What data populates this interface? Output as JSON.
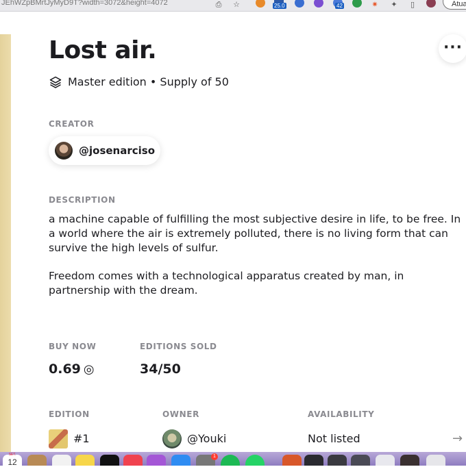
{
  "browser": {
    "url_fragment": "JEhWZpBMrtJyMyD9T?width=3072&height=4072",
    "ext_badges": [
      "25.0",
      "42"
    ],
    "profile_label": "Atua"
  },
  "artwork": {
    "title": "Lost air.",
    "edition_text": "Master edition • Supply of 50"
  },
  "creator": {
    "section_label": "CREATOR",
    "handle": "@josenarciso"
  },
  "description": {
    "section_label": "DESCRIPTION",
    "paragraphs": [
      "a machine capable of fulfilling the most subjective desire in life, to be free. In a world where the air is extremely polluted, there is no living form that can survive the high levels of sulfur.",
      "Freedom comes with a technological apparatus created by man, in partnership with the dream."
    ]
  },
  "sale": {
    "buy_now_label": "BUY NOW",
    "price": "0.69",
    "currency_symbol": "◎",
    "editions_sold_label": "EDITIONS SOLD",
    "editions_sold": "34/50"
  },
  "editions_table": {
    "headers": [
      "EDITION",
      "OWNER",
      "AVAILABILITY"
    ],
    "rows": [
      {
        "edition": "#1",
        "owner": "@Youki",
        "availability": "Not listed"
      }
    ]
  },
  "dock": {
    "calendar_month": "SET.",
    "calendar_day": "12",
    "badge": "1"
  },
  "colors": {
    "accent_text": "#1c1c20",
    "label_gray": "#8a8a90",
    "dock": "#9a8bc8"
  }
}
